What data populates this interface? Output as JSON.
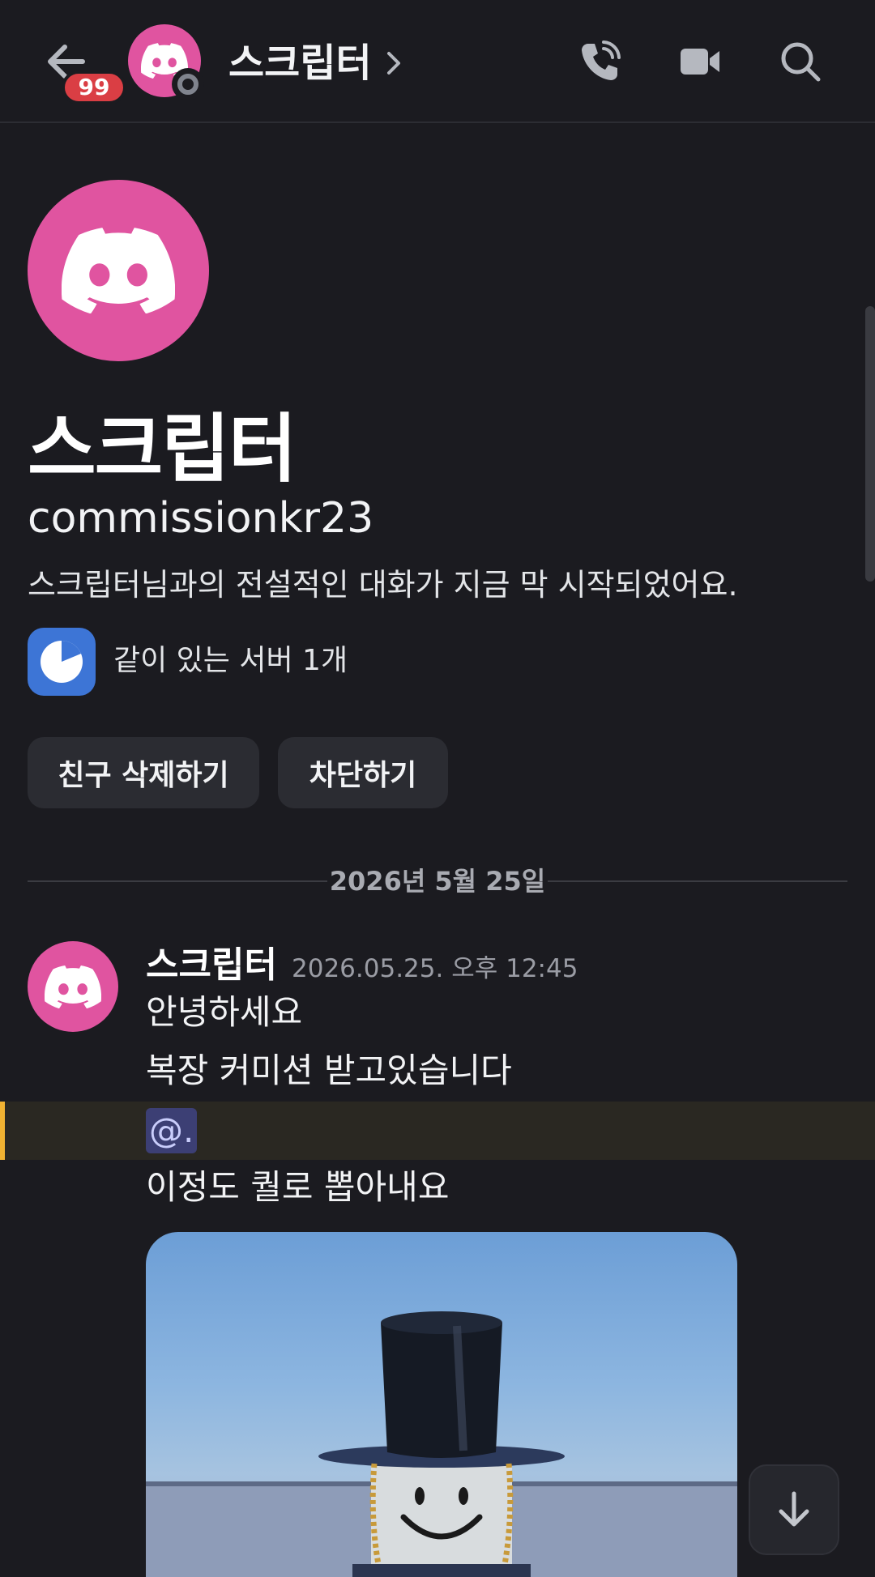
{
  "header": {
    "unread_count": "99",
    "title": "스크립터"
  },
  "profile": {
    "display_name": "스크립터",
    "username": "commissionkr23",
    "intro": "스크립터님과의 전설적인 대화가 지금 막 시작되었어요.",
    "mutual_servers": "같이 있는 서버 1개",
    "remove_friend_label": "친구 삭제하기",
    "block_label": "차단하기"
  },
  "date_divider": "2026년 5월 25일",
  "message": {
    "author": "스크립터",
    "timestamp": "2026.05.25. 오후 12:45",
    "lines": [
      "안녕하세요",
      "복장 커미션 받고있습니다",
      "이정도 퀄로 뽑아내요"
    ],
    "mention": "@."
  },
  "colors": {
    "background": "#1b1b20",
    "avatar_pink": "#e054a0",
    "badge_red": "#da3e44",
    "mention_highlight": "#f0b232",
    "server_blue": "#3d75d6"
  },
  "icons": {
    "back": "arrow-left-icon",
    "call": "phone-icon",
    "video": "video-camera-icon",
    "search": "search-icon",
    "scroll": "arrow-down-icon"
  }
}
